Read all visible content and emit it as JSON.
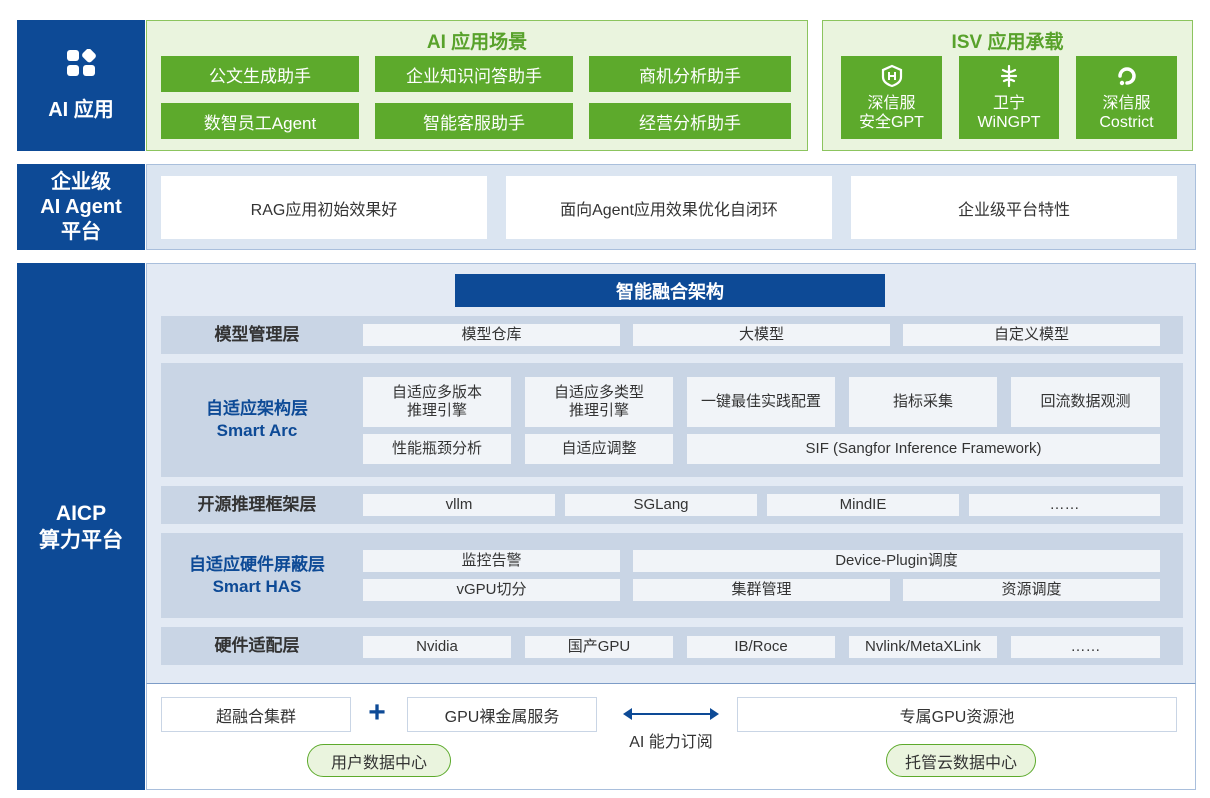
{
  "ai_app": {
    "label": "AI 应用",
    "logo": "apps-grid-icon",
    "scenarios": {
      "title": "AI 应用场景",
      "items": [
        "公文生成助手",
        "企业知识问答助手",
        "商机分析助手",
        "数智员工Agent",
        "智能客服助手",
        "经营分析助手"
      ]
    },
    "isv": {
      "title": "ISV 应用承载",
      "items": [
        {
          "icon": "sangfor-security-icon",
          "line1": "深信服",
          "line2": "安全GPT"
        },
        {
          "icon": "weining-icon",
          "line1": "卫宁",
          "line2": "WiNGPT"
        },
        {
          "icon": "costrict-icon",
          "line1": "深信服",
          "line2": "Costrict"
        }
      ]
    }
  },
  "agent_platform": {
    "label_lines": [
      "企业级",
      "AI Agent",
      "平台"
    ],
    "items": [
      "RAG应用初始效果好",
      "面向Agent应用效果优化自闭环",
      "企业级平台特性"
    ]
  },
  "aicp": {
    "label_lines": [
      "AICP",
      "算力平台"
    ],
    "architecture_title": "智能融合架构",
    "model_layer": {
      "label": "模型管理层",
      "items": [
        "模型仓库",
        "大模型",
        "自定义模型"
      ]
    },
    "adaptive_arch": {
      "label_lines": [
        "自适应架构层",
        "Smart Arc"
      ],
      "row1": [
        "自适应多版本\n推理引擎",
        "自适应多类型\n推理引擎",
        "一键最佳实践配置",
        "指标采集",
        "回流数据观测"
      ],
      "row2": [
        "性能瓶颈分析",
        "自适应调整",
        "SIF (Sangfor Inference Framework)"
      ]
    },
    "open_source": {
      "label": "开源推理框架层",
      "items": [
        "vllm",
        "SGLang",
        "MindIE",
        "……"
      ]
    },
    "adaptive_hw": {
      "label_lines": [
        "自适应硬件屏蔽层",
        "Smart HAS"
      ],
      "row1": [
        "监控告警",
        "Device-Plugin调度"
      ],
      "row2": [
        "vGPU切分",
        "集群管理",
        "资源调度"
      ]
    },
    "hw_adapt": {
      "label": "硬件适配层",
      "items": [
        "Nvidia",
        "国产GPU",
        "IB/Roce",
        "Nvlink/MetaXLink",
        "……"
      ]
    },
    "bottom": {
      "hyper_cluster": "超融合集群",
      "plus": "+",
      "bare_metal": "GPU裸金属服务",
      "ai_subscription": "AI 能力订阅",
      "dedicated_pool": "专属GPU资源池",
      "user_dc": "用户数据中心",
      "hosted_dc": "托管云数据中心"
    }
  },
  "colors": {
    "navy": "#0d4a96",
    "green": "#5daa2c",
    "green_light": "#eaf4de",
    "blue_light": "#e3eaf4",
    "layer_band": "#c9d5e5"
  }
}
